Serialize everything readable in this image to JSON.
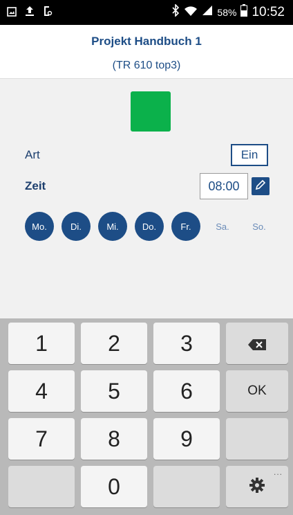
{
  "status_bar": {
    "battery_percent": "58%",
    "time": "10:52"
  },
  "header": {
    "title": "Projekt Handbuch 1",
    "subtitle": "(TR 610 top3)"
  },
  "status_color": "#0bb14b",
  "fields": {
    "art_label": "Art",
    "art_value": "Ein",
    "zeit_label": "Zeit",
    "zeit_value": "08:00"
  },
  "days": [
    {
      "label": "Mo.",
      "active": true
    },
    {
      "label": "Di.",
      "active": true
    },
    {
      "label": "Mi.",
      "active": true
    },
    {
      "label": "Do.",
      "active": true
    },
    {
      "label": "Fr.",
      "active": true
    },
    {
      "label": "Sa.",
      "active": false
    },
    {
      "label": "So.",
      "active": false
    }
  ],
  "keyboard": {
    "keys": [
      "1",
      "2",
      "3",
      "4",
      "5",
      "6",
      "7",
      "8",
      "9",
      "0"
    ],
    "ok_label": "OK",
    "more_indicator": "..."
  },
  "colors": {
    "accent": "#1d4d86",
    "keyboard_bg": "#b9b9b9"
  }
}
